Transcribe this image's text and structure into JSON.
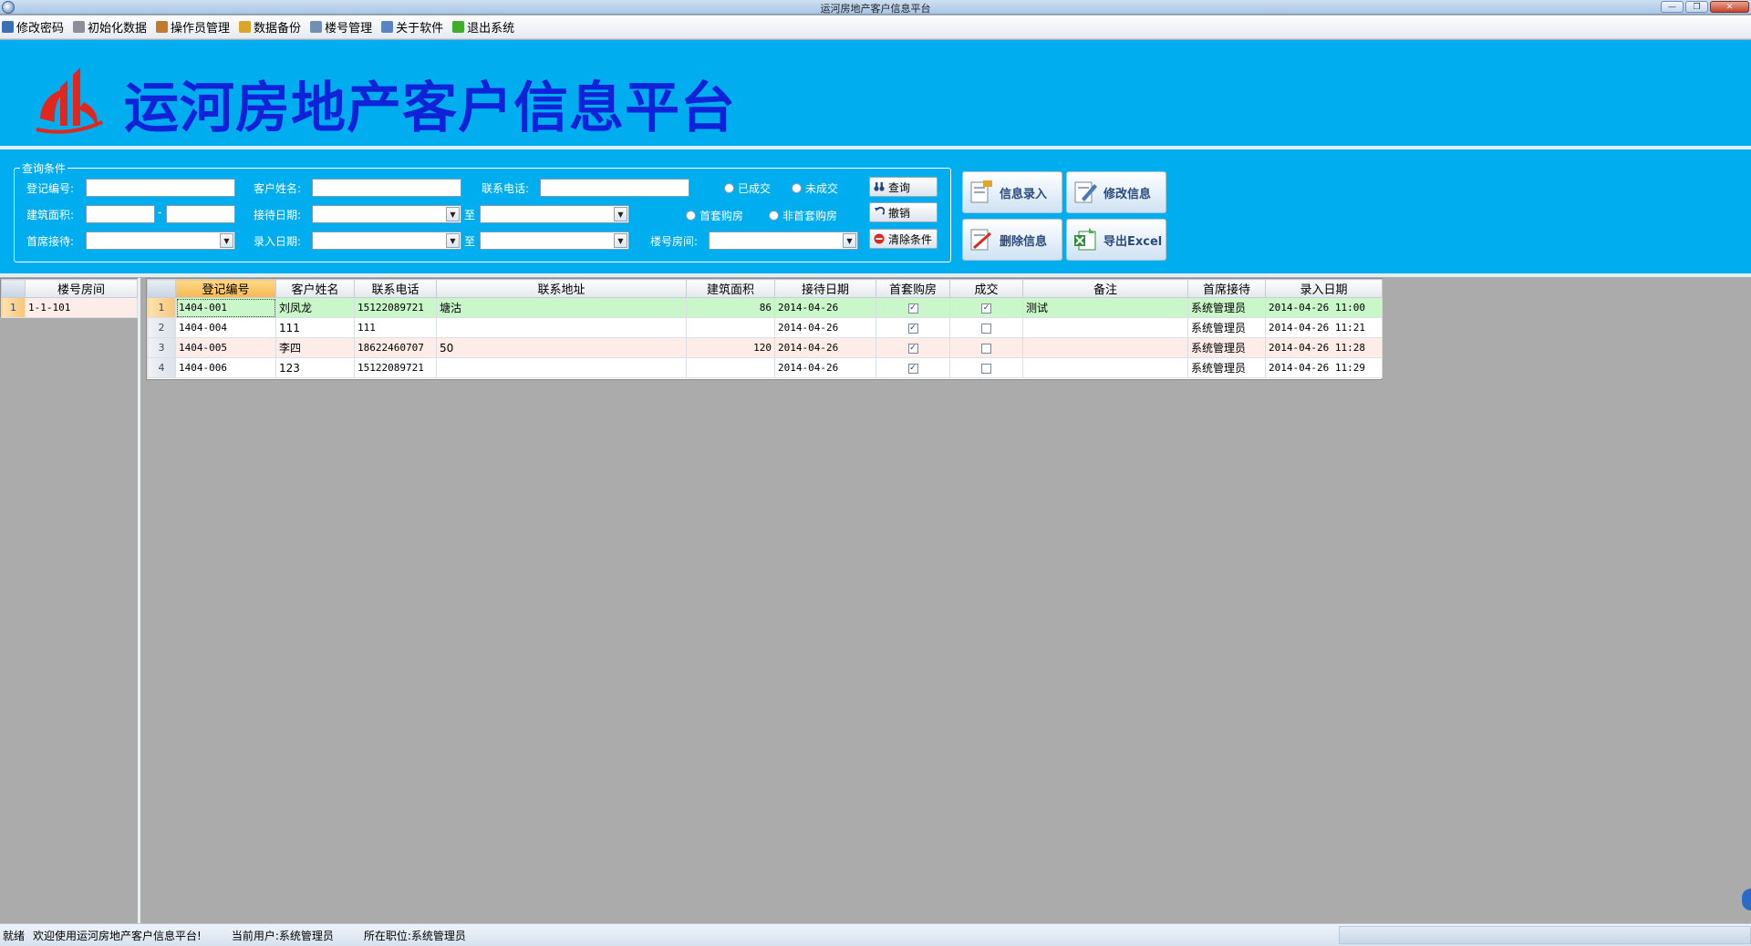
{
  "window": {
    "title": "运河房地产客户信息平台"
  },
  "menu": [
    {
      "label": "修改密码",
      "icon": "key-icon",
      "color": "#3b6fb6"
    },
    {
      "label": "初始化数据",
      "icon": "gear-icon",
      "color": "#8a8f99"
    },
    {
      "label": "操作员管理",
      "icon": "users-icon",
      "color": "#c27a2e"
    },
    {
      "label": "数据备份",
      "icon": "backup-icon",
      "color": "#d9a62b"
    },
    {
      "label": "楼号管理",
      "icon": "building-icon",
      "color": "#6f8fb3"
    },
    {
      "label": "关于软件",
      "icon": "monitor-icon",
      "color": "#5a84c4"
    },
    {
      "label": "退出系统",
      "icon": "exit-arrow-icon",
      "color": "#3fae2a"
    }
  ],
  "banner": {
    "title": "运河房地产客户信息平台",
    "background": "#00aef0",
    "title_color": "#0f22d8",
    "logo_color": "#e0261d"
  },
  "query": {
    "legend": "查询条件",
    "reg_no_label": "登记编号:",
    "customer_name_label": "客户姓名:",
    "phone_label": "联系电话:",
    "area_label": "建筑面积:",
    "area_dash": "-",
    "reception_date_label": "接待日期:",
    "entry_date_label": "录入日期:",
    "to_label": "至",
    "chief_reception_label": "首席接待:",
    "building_room_label": "楼号房间:",
    "radio_deal": "已成交",
    "radio_no_deal": "未成交",
    "radio_first": "首套购房",
    "radio_not_first": "非首套购房",
    "btn_search": "查询",
    "btn_cancel": "撤销",
    "btn_clear": "清除条件"
  },
  "actions": {
    "add": "信息录入",
    "edit": "修改信息",
    "delete": "删除信息",
    "export": "导出Excel"
  },
  "left_grid": {
    "header": "楼号房间",
    "rows": [
      {
        "index": "1",
        "room": "1-1-101"
      }
    ]
  },
  "main_grid": {
    "columns": [
      "登记编号",
      "客户姓名",
      "联系电话",
      "联系地址",
      "建筑面积",
      "接待日期",
      "首套购房",
      "成交",
      "备注",
      "首席接待",
      "录入日期"
    ],
    "rows": [
      {
        "index": "1",
        "reg_no": "1404-001",
        "name": "刘凤龙",
        "phone": "15122089721",
        "address": "塘沽",
        "area": "86",
        "reception_date": "2014-04-26",
        "first_home": true,
        "deal": true,
        "note": "测试",
        "chief": "系统管理员",
        "entry_date": "2014-04-26 11:00"
      },
      {
        "index": "2",
        "reg_no": "1404-004",
        "name": "111",
        "phone": "111",
        "address": "",
        "area": "",
        "reception_date": "2014-04-26",
        "first_home": true,
        "deal": false,
        "note": "",
        "chief": "系统管理员",
        "entry_date": "2014-04-26 11:21"
      },
      {
        "index": "3",
        "reg_no": "1404-005",
        "name": "李四",
        "phone": "18622460707",
        "address": "50",
        "area": "120",
        "reception_date": "2014-04-26",
        "first_home": true,
        "deal": false,
        "note": "",
        "chief": "系统管理员",
        "entry_date": "2014-04-26 11:28"
      },
      {
        "index": "4",
        "reg_no": "1404-006",
        "name": "123",
        "phone": "15122089721",
        "address": "",
        "area": "",
        "reception_date": "2014-04-26",
        "first_home": true,
        "deal": false,
        "note": "",
        "chief": "系统管理员",
        "entry_date": "2014-04-26 11:29"
      }
    ]
  },
  "status": {
    "ready": "就绪",
    "welcome": "欢迎使用运河房地产客户信息平台!",
    "current_user": "当前用户:系统管理员",
    "position": "所在职位:系统管理员"
  }
}
